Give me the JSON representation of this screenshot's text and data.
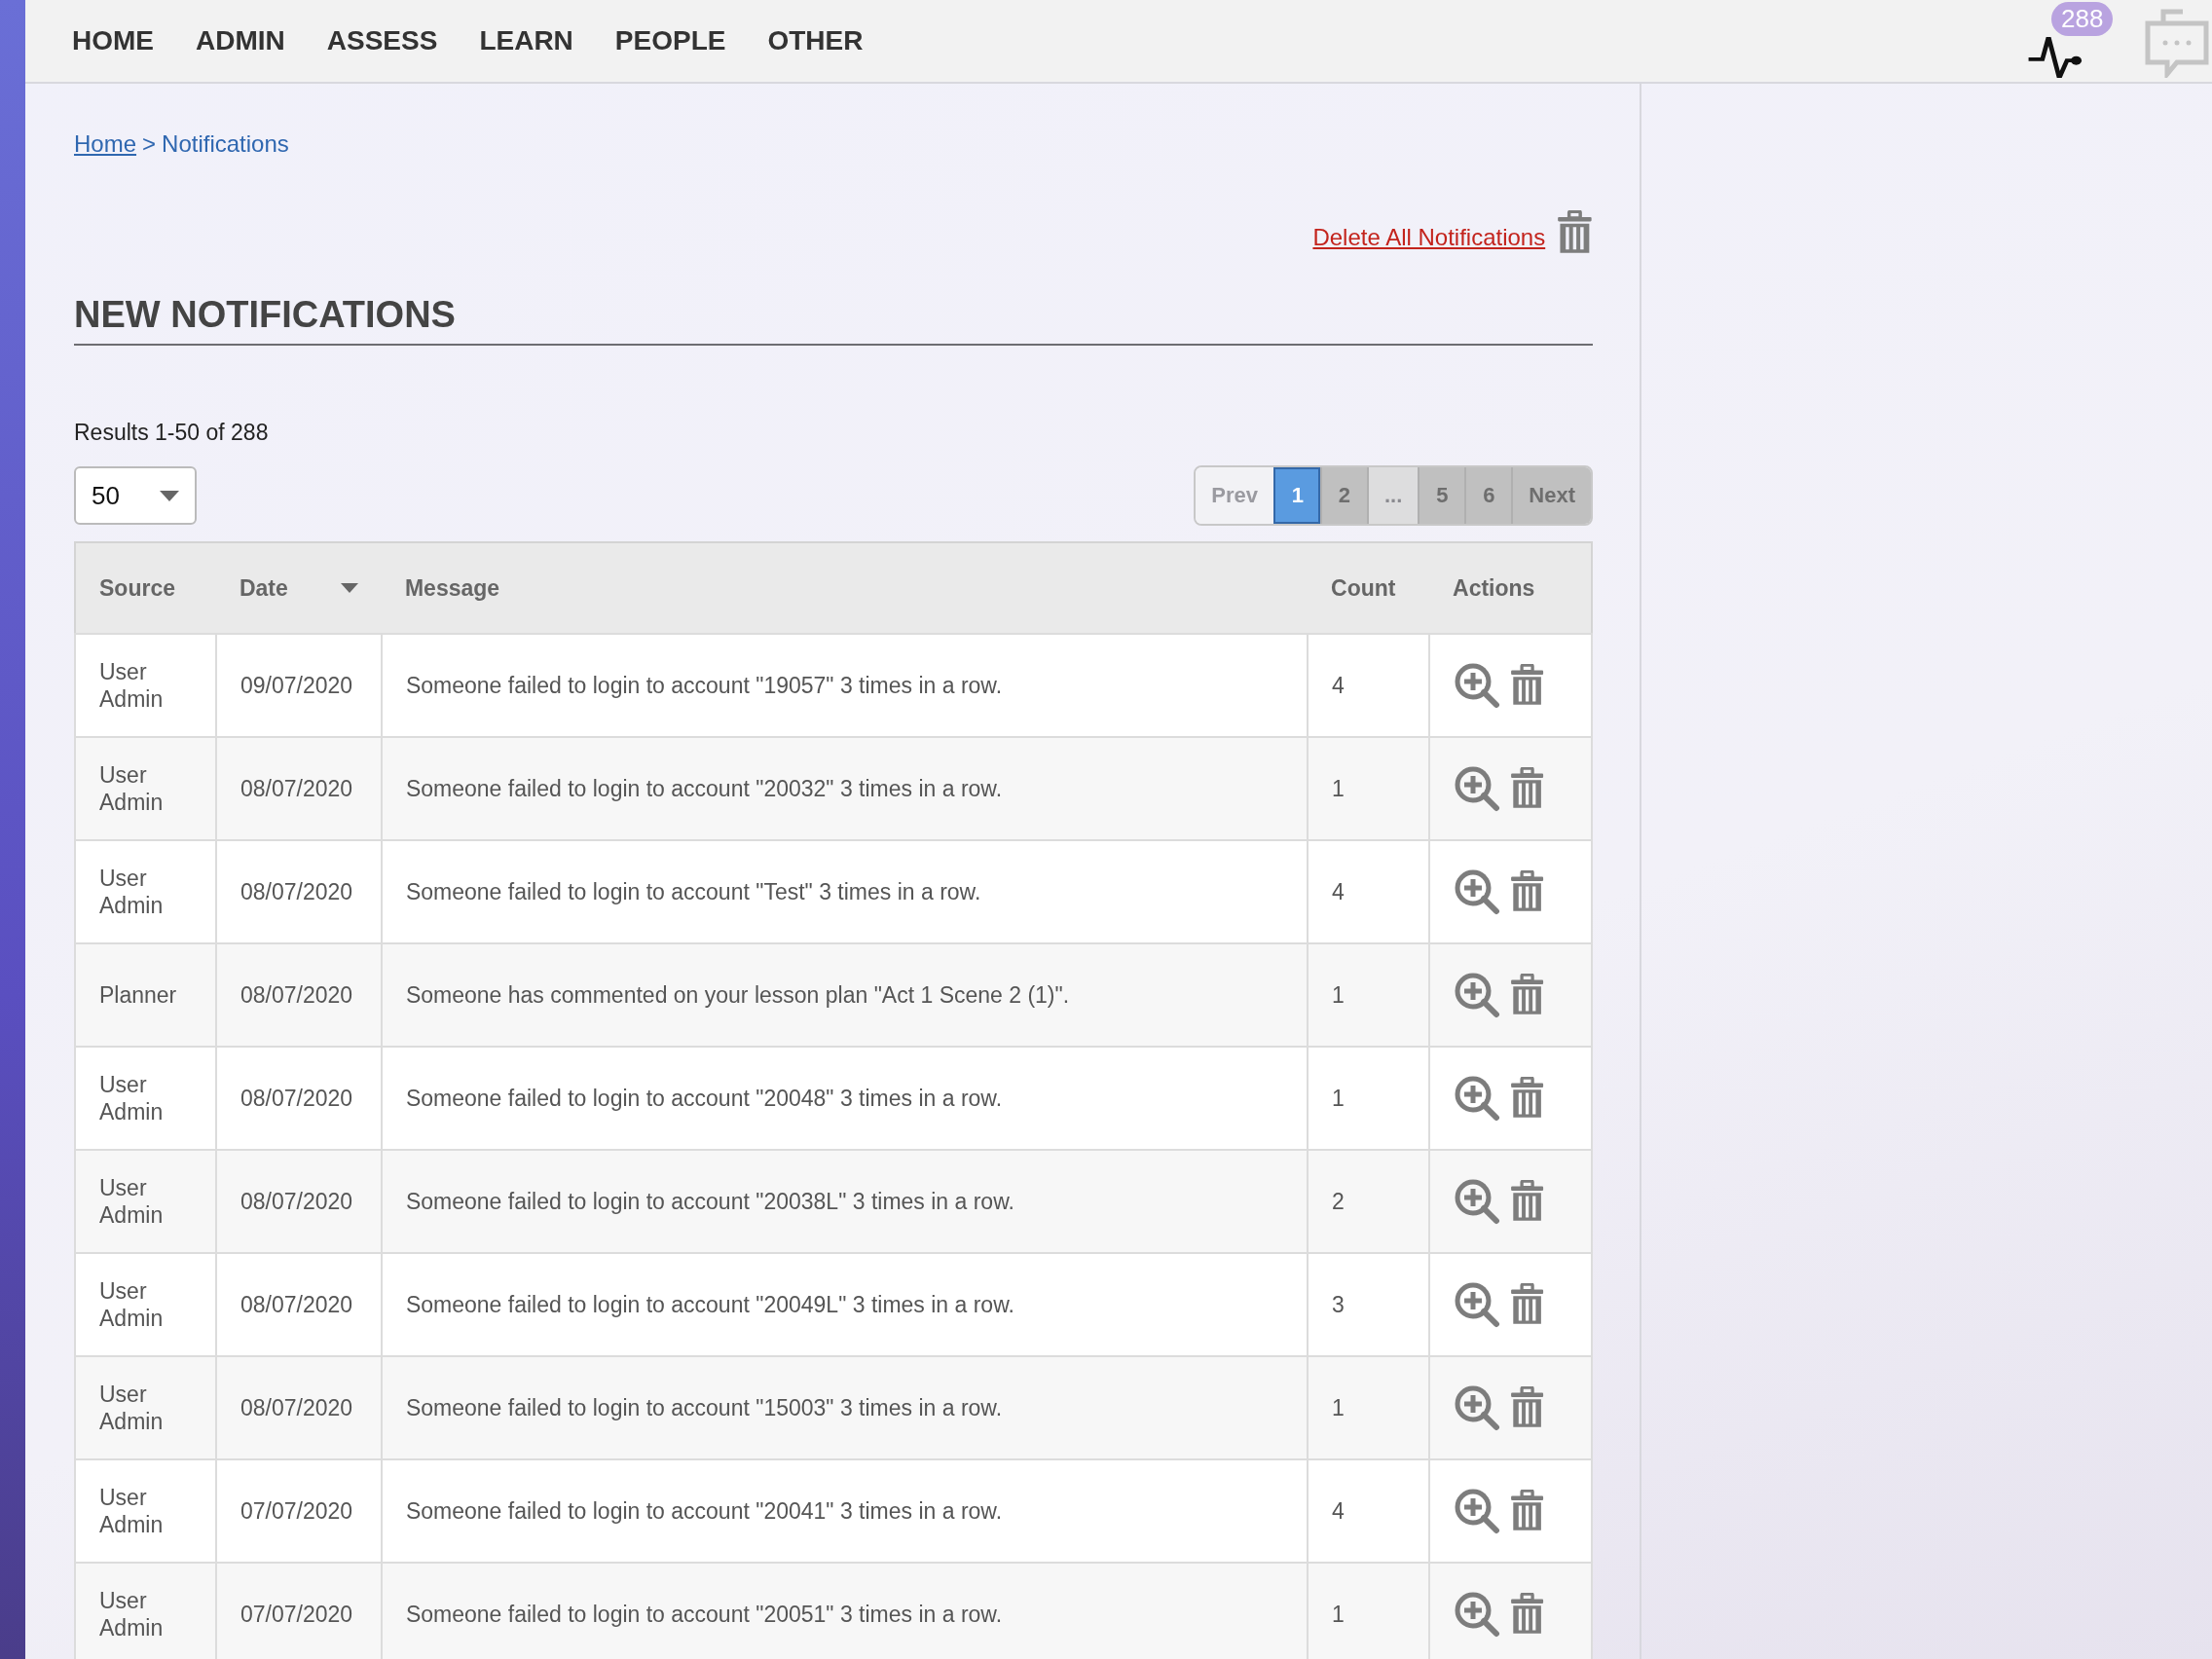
{
  "nav": {
    "items": [
      "HOME",
      "ADMIN",
      "ASSESS",
      "LEARN",
      "PEOPLE",
      "OTHER"
    ],
    "activity_badge": "288"
  },
  "breadcrumb": {
    "link": "Home",
    "separator": ">",
    "current": "Notifications"
  },
  "delete_all": "Delete All Notifications",
  "heading": "NEW NOTIFICATIONS",
  "results": "Results 1-50 of 288",
  "page_size": {
    "value": "50"
  },
  "pagination": [
    {
      "label": "Prev",
      "kind": "nav",
      "disabled": true,
      "selected": false
    },
    {
      "label": "1",
      "kind": "page",
      "disabled": false,
      "selected": true
    },
    {
      "label": "2",
      "kind": "page",
      "disabled": false,
      "selected": false
    },
    {
      "label": "...",
      "kind": "gap",
      "disabled": true,
      "selected": false
    },
    {
      "label": "5",
      "kind": "page",
      "disabled": false,
      "selected": false
    },
    {
      "label": "6",
      "kind": "page",
      "disabled": false,
      "selected": false
    },
    {
      "label": "Next",
      "kind": "nav",
      "disabled": false,
      "selected": false
    }
  ],
  "table": {
    "columns": [
      {
        "label": "Source",
        "sorted": false
      },
      {
        "label": "Date",
        "sorted": true
      },
      {
        "label": "Message",
        "sorted": false
      },
      {
        "label": "Count",
        "sorted": false
      },
      {
        "label": "Actions",
        "sorted": false
      }
    ],
    "rows": [
      {
        "source": "User Admin",
        "date": "09/07/2020",
        "message": "Someone failed to login to account \"19057\" 3 times in a row.",
        "count": "4"
      },
      {
        "source": "User Admin",
        "date": "08/07/2020",
        "message": "Someone failed to login to account \"20032\" 3 times in a row.",
        "count": "1"
      },
      {
        "source": "User Admin",
        "date": "08/07/2020",
        "message": "Someone failed to login to account \"Test\" 3 times in a row.",
        "count": "4"
      },
      {
        "source": "Planner",
        "date": "08/07/2020",
        "message": "Someone has commented on your lesson plan \"Act 1 Scene 2 (1)\".",
        "count": "1"
      },
      {
        "source": "User Admin",
        "date": "08/07/2020",
        "message": "Someone failed to login to account \"20048\" 3 times in a row.",
        "count": "1"
      },
      {
        "source": "User Admin",
        "date": "08/07/2020",
        "message": "Someone failed to login to account \"20038L\" 3 times in a row.",
        "count": "2"
      },
      {
        "source": "User Admin",
        "date": "08/07/2020",
        "message": "Someone failed to login to account \"20049L\" 3 times in a row.",
        "count": "3"
      },
      {
        "source": "User Admin",
        "date": "08/07/2020",
        "message": "Someone failed to login to account \"15003\" 3 times in a row.",
        "count": "1"
      },
      {
        "source": "User Admin",
        "date": "07/07/2020",
        "message": "Someone failed to login to account \"20041\" 3 times in a row.",
        "count": "4"
      },
      {
        "source": "User Admin",
        "date": "07/07/2020",
        "message": "Someone failed to login to account \"20051\" 3 times in a row.",
        "count": "1"
      }
    ]
  }
}
